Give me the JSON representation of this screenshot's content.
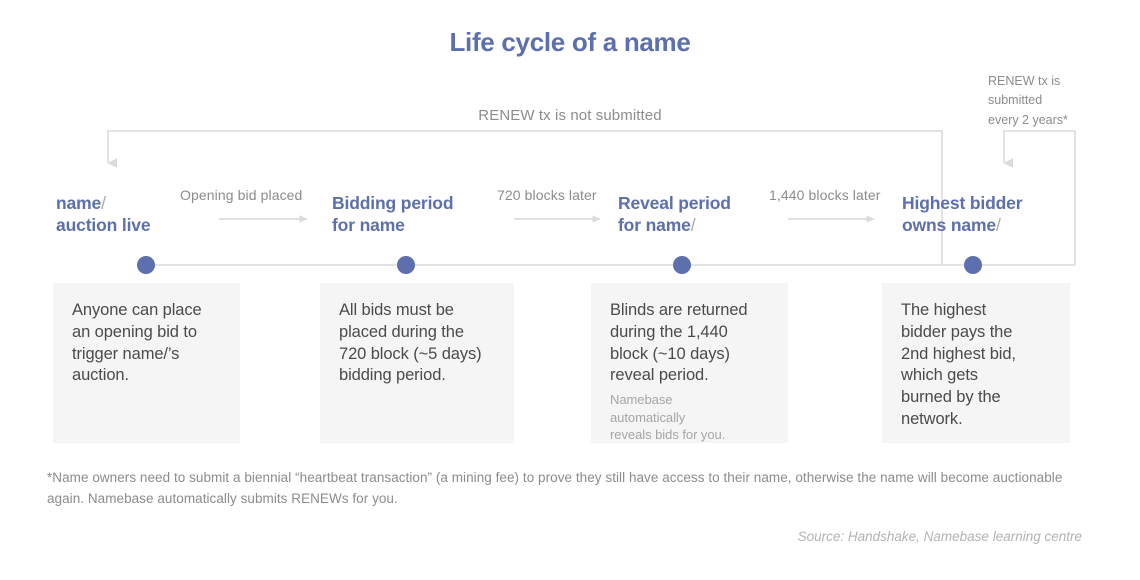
{
  "title": "Life cycle of a name",
  "colors": {
    "accent": "#5d6fad",
    "wire": "#dcdcdc",
    "card_bg": "#f5f5f5",
    "muted_text": "#8c8c8c",
    "body_text": "#4b4b4b",
    "slash": "#a9a9a9"
  },
  "loops": {
    "not_renewed_label": "RENEW tx is not submitted",
    "renewed_label": "RENEW tx is\nsubmitted\nevery 2 years*"
  },
  "stages": [
    {
      "title_line1": "name",
      "slash1": "/",
      "title_line2": "auction live",
      "slash2": "",
      "card_main": "Anyone can place\nan opening bid to\ntrigger name/’s\nauction.",
      "card_sub": ""
    },
    {
      "title_line1": "Bidding period",
      "slash1": "",
      "title_line2": "for name",
      "slash2": "",
      "card_main": "All bids must be\nplaced during the\n720 block (~5 days)\nbidding period.",
      "card_sub": ""
    },
    {
      "title_line1": "Reveal period",
      "slash1": "",
      "title_line2": "for name",
      "slash2": "/",
      "card_main": "Blinds are returned\nduring the 1,440\nblock (~10 days)\nreveal period.",
      "card_sub": "Namebase\nautomatically\nreveals bids for you."
    },
    {
      "title_line1": "Highest bidder",
      "slash1": "",
      "title_line2": "owns name",
      "slash2": "/",
      "card_main": "The highest\nbidder pays the\n2nd highest bid,\nwhich gets\nburned by the\nnetwork.",
      "card_sub": ""
    }
  ],
  "transitions": [
    {
      "label": "Opening bid placed"
    },
    {
      "label": "720 blocks later"
    },
    {
      "label": "1,440 blocks later"
    }
  ],
  "footnote": "*Name owners need to submit a biennial “heartbeat transaction” (a mining fee) to prove they still have access to their name, otherwise the name will become auctionable again. Namebase automatically submits RENEWs for you.",
  "source": "Source: Handshake, Namebase learning centre"
}
